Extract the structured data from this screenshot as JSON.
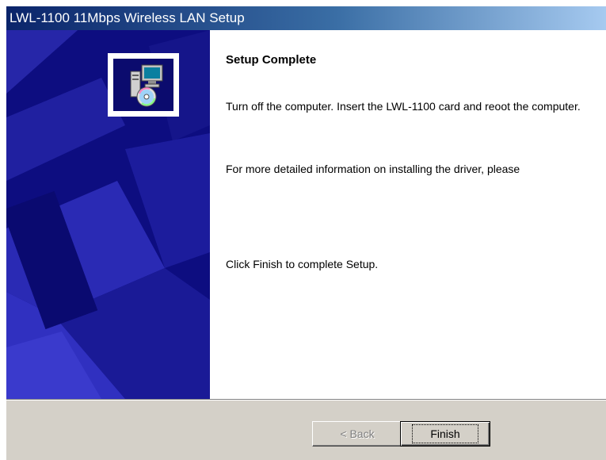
{
  "window": {
    "title": "LWL-1100 11Mbps Wireless LAN Setup"
  },
  "banner": {
    "icon": "setup-computer-cd-icon",
    "colors": {
      "dark": "#0d0d80",
      "mid": "#2b2bb8",
      "light": "#3d3dd0"
    }
  },
  "content": {
    "heading": "Setup Complete",
    "paragraph1": "Turn off the computer. Insert the LWL-1100 card and reoot the computer.",
    "paragraph2": "For more detailed information on installing the driver, please",
    "paragraph3": "Click Finish to complete Setup."
  },
  "buttons": {
    "back_label": "< Back",
    "finish_label": "Finish"
  }
}
